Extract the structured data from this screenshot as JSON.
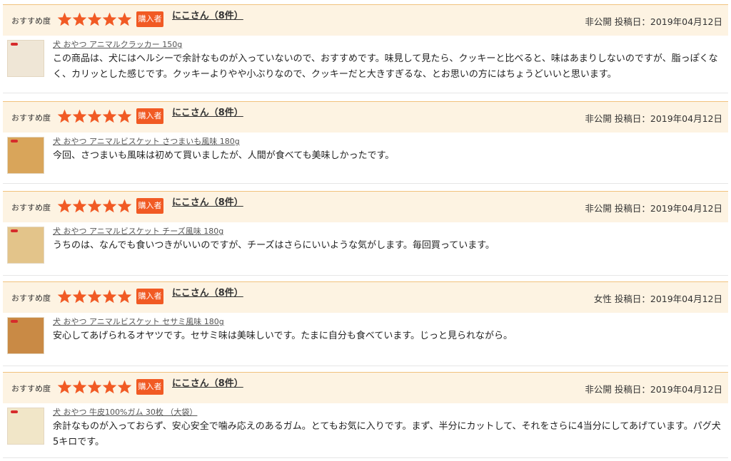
{
  "reviews": [
    {
      "rec_label": "おすすめ度",
      "stars": 5,
      "buyer_badge": "購入者",
      "user": "にこさん（8件）",
      "gender": "非公開",
      "posted": "投稿日：2019年04月12日",
      "product": "犬 おやつ アニマルクラッカー 150g",
      "text": "この商品は、犬にはヘルシーで余計なものが入っていないので、おすすめです。味見して見たら、クッキーと比べると、味はあまりしないのですが、脂っぽくなく、カリッとした感じです。クッキーよりやや小ぶりなので、クッキーだと大きすぎるな、とお思いの方にはちょうどいいと思います。",
      "thumb_color": "#efe6d6",
      "thumb_label": "アニマルクラッカー"
    },
    {
      "rec_label": "おすすめ度",
      "stars": 5,
      "buyer_badge": "購入者",
      "user": "にこさん（8件）",
      "gender": "非公開",
      "posted": "投稿日：2019年04月12日",
      "product": "犬 おやつ アニマルビスケット さつまいも風味 180g",
      "text": "今回、さつまいも風味は初めて買いましたが、人間が食べても美味しかったです。",
      "thumb_color": "#d9a55a",
      "thumb_label": "アニマルビスケット さつまいも風味"
    },
    {
      "rec_label": "おすすめ度",
      "stars": 5,
      "buyer_badge": "購入者",
      "user": "にこさん（8件）",
      "gender": "非公開",
      "posted": "投稿日：2019年04月12日",
      "product": "犬 おやつ アニマルビスケット チーズ風味 180g",
      "text": "うちのは、なんでも食いつきがいいのですが、チーズはさらにいいような気がします。毎回買っています。",
      "thumb_color": "#e3c48a",
      "thumb_label": "アニマルビスケット チーズ風味"
    },
    {
      "rec_label": "おすすめ度",
      "stars": 5,
      "buyer_badge": "購入者",
      "user": "にこさん（8件）",
      "gender": "女性",
      "posted": "投稿日：2019年04月12日",
      "product": "犬 おやつ アニマルビスケット セサミ風味 180g",
      "text": "安心してあげられるオヤツです。セサミ味は美味しいです。たまに自分も食べています。じっと見られながら。",
      "thumb_color": "#c98a45",
      "thumb_label": "アニマルビスケット セサミ風味"
    },
    {
      "rec_label": "おすすめ度",
      "stars": 5,
      "buyer_badge": "購入者",
      "user": "にこさん（8件）",
      "gender": "非公開",
      "posted": "投稿日：2019年04月12日",
      "product": "犬 おやつ 牛皮100%ガム 30枚 （大袋）",
      "text": "余計なものが入っておらず、安心安全で噛み応えのあるガム。とてもお気に入りです。まず、半分にカットして、それをさらに4当分にしてあげています。パグ犬5キロです。",
      "thumb_color": "#f1e6c8",
      "thumb_label": "牛皮100%ガム"
    }
  ],
  "colors": {
    "star": "#f15a24",
    "header_bg": "#fdf3e2",
    "header_border": "#f1c27d",
    "badge": "#f15a24"
  }
}
